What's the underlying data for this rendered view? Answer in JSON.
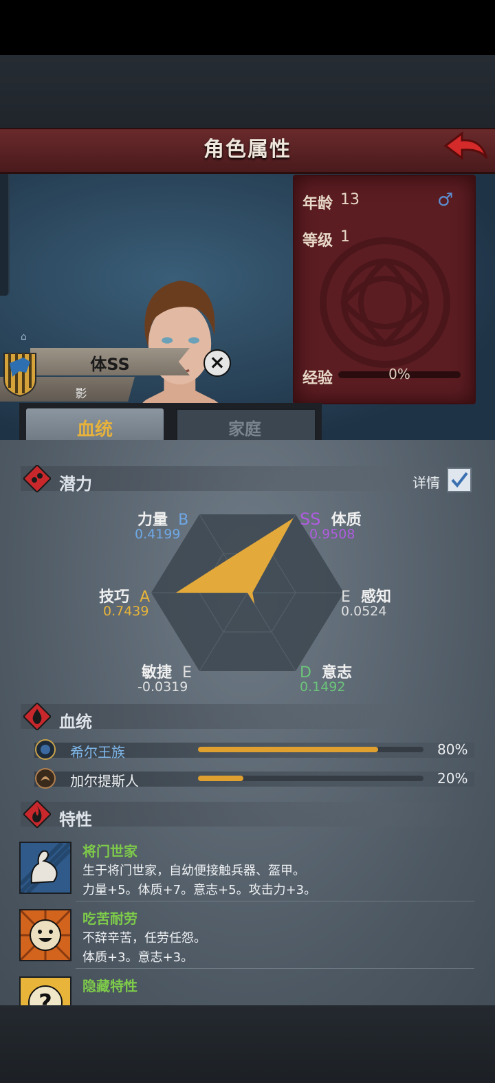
{
  "header": {
    "title": "角色属性"
  },
  "info": {
    "age_label": "年龄",
    "age_value": "13",
    "level_label": "等级",
    "level_value": "1",
    "exp_label": "经验",
    "exp_value": "0%",
    "gender_icon": "male-icon"
  },
  "character": {
    "banner_name": "体SS",
    "banner_sub": "影"
  },
  "tabs": [
    {
      "label": "血统",
      "active": true
    },
    {
      "label": "家庭",
      "active": false
    }
  ],
  "potential": {
    "title": "潜力",
    "detail_label": "详情",
    "detail_checked": true,
    "stats": [
      {
        "name": "力量",
        "grade": "B",
        "value": "0.4199",
        "grade_color": "#6fa8e6",
        "value_color": "#6fa8e6"
      },
      {
        "name": "体质",
        "grade": "SS",
        "value": "0.9508",
        "grade_color": "#b05ce0",
        "value_color": "#b05ce0"
      },
      {
        "name": "技巧",
        "grade": "A",
        "value": "0.7439",
        "grade_color": "#e8b43a",
        "value_color": "#e8b43a"
      },
      {
        "name": "感知",
        "grade": "E",
        "value": "0.0524",
        "grade_color": "#e0e0e0",
        "value_color": "#e0e0e0"
      },
      {
        "name": "敏捷",
        "grade": "E",
        "value": "-0.0319",
        "grade_color": "#e0e0e0",
        "value_color": "#e0e0e0"
      },
      {
        "name": "意志",
        "grade": "D",
        "value": "0.1492",
        "grade_color": "#6cc47a",
        "value_color": "#6cc47a"
      }
    ]
  },
  "bloodline": {
    "title": "血统",
    "entries": [
      {
        "name": "希尔王族",
        "percent": "80%",
        "fill": 0.8,
        "name_color": "#7fb6e8"
      },
      {
        "name": "加尔提斯人",
        "percent": "20%",
        "fill": 0.2,
        "name_color": "#eef0f2"
      }
    ]
  },
  "traits": {
    "title": "特性",
    "items": [
      {
        "name": "将门世家",
        "desc1": "生于将门世家，自幼便接触兵器、盔甲。",
        "desc2": "力量+5。体质+7。意志+5。攻击力+3。",
        "icon": "flexing-arm-icon"
      },
      {
        "name": "吃苦耐劳",
        "desc1": "不辞辛苦，任劳任怨。",
        "desc2": "体质+3。意志+3。",
        "icon": "smiling-face-icon"
      },
      {
        "name": "隐藏特性",
        "desc1": "",
        "desc2": "",
        "icon": "question-mark-icon"
      }
    ]
  },
  "colors": {
    "accent_gold": "#e6b23c",
    "panel_red": "#5b1d22",
    "trait_green": "#7ecb4a"
  }
}
